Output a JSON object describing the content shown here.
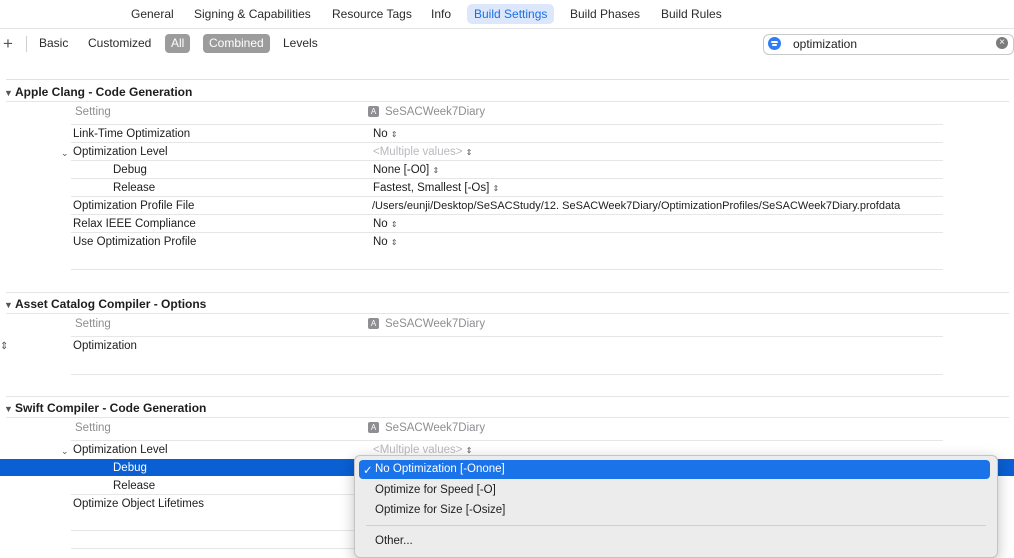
{
  "tabs": [
    "General",
    "Signing & Capabilities",
    "Resource Tags",
    "Info",
    "Build Settings",
    "Build Phases",
    "Build Rules"
  ],
  "active_tab": "Build Settings",
  "filter": {
    "add_label": "+",
    "basic": "Basic",
    "customized": "Customized",
    "all": "All",
    "combined": "Combined",
    "levels": "Levels"
  },
  "search": {
    "value": "optimization",
    "clear": "×"
  },
  "header_setting": "Setting",
  "target_name": "SeSACWeek7Diary",
  "target_icon": "app-target-icon",
  "sections": {
    "clang": {
      "title": "Apple Clang - Code Generation",
      "rows": [
        {
          "label": "Link-Time Optimization",
          "value": "No",
          "stepper": true
        },
        {
          "label": "Optimization Level",
          "value": "<Multiple values>",
          "stepper": true
        },
        {
          "label": "Debug",
          "value": "None [-O0]",
          "stepper": true
        },
        {
          "label": "Release",
          "value": "Fastest, Smallest [-Os]",
          "stepper": true
        },
        {
          "label": "Optimization Profile File",
          "value": "/Users/eunji/Desktop/SeSACStudy/12. SeSACWeek7Diary/OptimizationProfiles/SeSACWeek7Diary.profdata",
          "stepper": false
        },
        {
          "label": "Relax IEEE Compliance",
          "value": "No",
          "stepper": true
        },
        {
          "label": "Use Optimization Profile",
          "value": "No",
          "stepper": true
        }
      ]
    },
    "asset": {
      "title": "Asset Catalog Compiler - Options",
      "rows": [
        {
          "label": "Optimization"
        }
      ]
    },
    "swift": {
      "title": "Swift Compiler - Code Generation",
      "rows": [
        {
          "label": "Optimization Level",
          "value": "<Multiple values>"
        },
        {
          "label": "Debug"
        },
        {
          "label": "Release"
        },
        {
          "label": "Optimize Object Lifetimes"
        }
      ]
    }
  },
  "popup": {
    "checkmark": "✓",
    "items": [
      "No Optimization [-Onone]",
      "Optimize for Speed [-O]",
      "Optimize for Size [-Osize]"
    ],
    "selected": "No Optimization [-Onone]",
    "other": "Other..."
  },
  "glyphs": {
    "stepper": "⌃⌄",
    "disclosure_open": "⌄",
    "updown": "⇕"
  },
  "colors": {
    "accent": "#1a73e8",
    "selected_row": "#0a5fd3",
    "active_tab_bg": "#dce7fb"
  }
}
